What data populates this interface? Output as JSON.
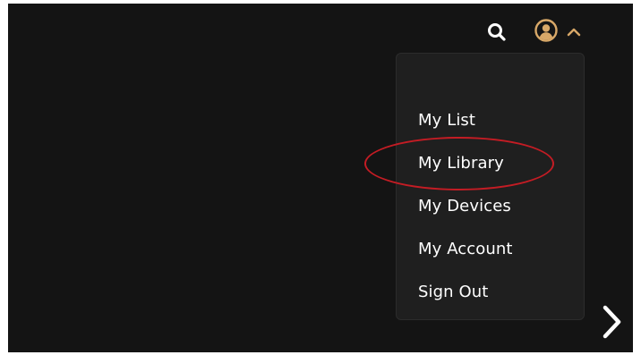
{
  "header": {
    "search_icon": "search-icon",
    "profile_icon": "user-circle-icon",
    "profile_caret_icon": "chevron-up-icon",
    "accent_color": "#d8a868"
  },
  "profile_menu": {
    "items": [
      {
        "label": "My List"
      },
      {
        "label": "My Library"
      },
      {
        "label": "My Devices"
      },
      {
        "label": "My Account"
      },
      {
        "label": "Sign Out"
      }
    ],
    "highlighted_item": "My Library",
    "highlight_color": "#c41c24"
  },
  "navigation": {
    "next_icon": "chevron-right-icon"
  },
  "colors": {
    "background": "#141414",
    "menu_background": "#1f1f1f",
    "text": "#ffffff"
  }
}
